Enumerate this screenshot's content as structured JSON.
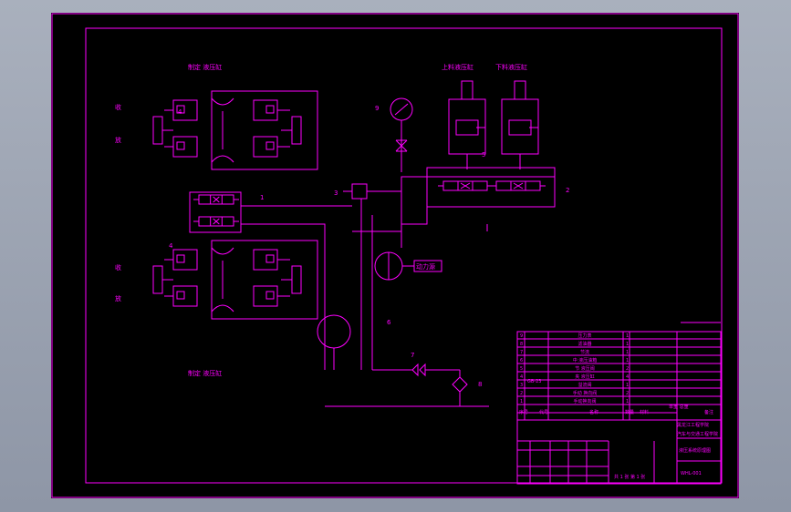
{
  "colors": {
    "background": "#000000",
    "frame": "#ff00ff",
    "line": "#ff00ff",
    "text": "#ff00ff",
    "viewport": "#9aa1b0"
  },
  "labels": {
    "top_cylinder_group": "制定 液压缸",
    "bottom_cylinder_group": "制定 液压缸",
    "top_retract": "收",
    "top_release": "放",
    "bottom_retract": "收",
    "bottom_release": "放",
    "upper_lift_cylinder": "上料液压缸",
    "lower_lift_cylinder": "下料液压缸",
    "power_unit": "动力源"
  },
  "callouts": {
    "n1": "1",
    "n2": "2",
    "n3": "3",
    "n4_top": "4",
    "n4_bottom": "4",
    "n5": "5",
    "n6": "6",
    "n7": "7",
    "n8": "8",
    "n9": "9"
  },
  "parts_list": {
    "rows": [
      {
        "no": "9",
        "name": "压力表",
        "qty": "1"
      },
      {
        "no": "8",
        "name": "滤油器",
        "qty": "1"
      },
      {
        "no": "7",
        "name": "节流",
        "qty": "1"
      },
      {
        "no": "6",
        "name": "中 液压油箱",
        "qty": "1"
      },
      {
        "no": "5",
        "name": "节 液压阀",
        "qty": "2"
      },
      {
        "no": "4",
        "name": "夹 液压缸",
        "qty": "4"
      },
      {
        "no": "3",
        "name": "溢流阀",
        "qty": "1"
      },
      {
        "no": "2",
        "name": "手动 换向阀",
        "qty": "2"
      },
      {
        "no": "1",
        "name": "手动换向阀",
        "qty": "1"
      }
    ],
    "std_code": "GB-23"
  },
  "title_block": {
    "header_no": "序号",
    "header_code": "代号",
    "header_name": "名称",
    "header_qty": "数量",
    "header_material": "材料",
    "header_weight": "单重 总重",
    "header_note": "备注",
    "school_line1": "黑龙江工程学院",
    "school_line2": "汽车与交通工程学院",
    "drawing_title": "液压系统原理图",
    "drawing_no": "WHL-001",
    "scale_note": "共 1 张 第 1 张"
  }
}
